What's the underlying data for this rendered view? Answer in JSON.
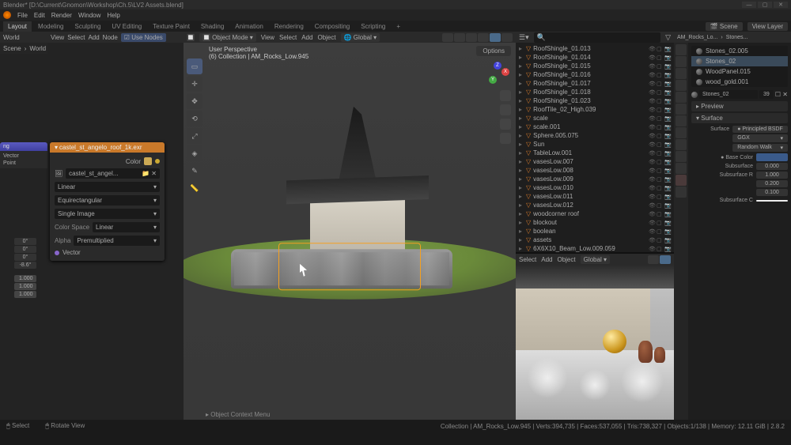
{
  "window": {
    "title": "Blender* [D:\\Current\\Gnomon\\Workshop\\Ch.5\\LV2 Assets.blend]"
  },
  "menubar": {
    "items": [
      "File",
      "Edit",
      "Render",
      "Window",
      "Help"
    ]
  },
  "workspace": {
    "tabs": [
      "Layout",
      "Modeling",
      "Sculpting",
      "UV Editing",
      "Texture Paint",
      "Shading",
      "Animation",
      "Rendering",
      "Compositing",
      "Scripting"
    ],
    "plus": "+",
    "scene": "Scene",
    "viewlayer": "View Layer"
  },
  "node_editor": {
    "header": {
      "mode": "World",
      "menus": [
        "View",
        "Select",
        "Add",
        "Node"
      ],
      "use_nodes": "Use Nodes"
    },
    "breadcrumb": [
      "Scene",
      "World"
    ],
    "frag_node": {
      "title": "ng",
      "sockets": [
        "Vector",
        "Point"
      ],
      "bottom_socket": "Vector"
    },
    "nums": [
      "0°",
      "0°",
      "0°",
      "-8.6°",
      "1.000",
      "1.000",
      "1.000"
    ],
    "image_node": {
      "title": "castel_st_angelo_roof_1k.exr",
      "color_out": "Color",
      "image_field": "castel_st_angel...",
      "interpolation": "Linear",
      "projection": "Equirectangular",
      "frame": "Single Image",
      "color_space_label": "Color Space",
      "color_space": "Linear",
      "alpha_label": "Alpha",
      "alpha": "Premultiplied",
      "vector_in": "Vector"
    }
  },
  "viewport": {
    "mode": "Object Mode",
    "menus": [
      "View",
      "Select",
      "Add",
      "Object"
    ],
    "orientation": "Global",
    "info1": "User Perspective",
    "info2": "(6) Collection | AM_Rocks_Low.945",
    "options": "Options",
    "bottom": "Object Context Menu"
  },
  "outliner": {
    "items": [
      "RoofShingle_01.013",
      "RoofShingle_01.014",
      "RoofShingle_01.015",
      "RoofShingle_01.016",
      "RoofShingle_01.017",
      "RoofShingle_01.018",
      "RoofShingle_01.023",
      "RoofTile_02_High.039",
      "scale",
      "scale.001",
      "Sphere.005.075",
      "Sun",
      "TableLow.001",
      "vasesLow.007",
      "vasesLow.008",
      "vasesLow.009",
      "vasesLow.010",
      "vasesLow.011",
      "vasesLow.012",
      "woodcorner roof",
      "blockout",
      "boolean",
      "assets",
      "6X6X10_Beam_Low.009.059"
    ]
  },
  "secondary": {
    "menus": [
      "Select",
      "Add",
      "Object"
    ],
    "orientation": "Global"
  },
  "properties": {
    "breadcrumb1": "AM_Rocks_Lo...",
    "breadcrumb2": "Stones...",
    "materials": [
      "Stones_02.005",
      "Stones_02",
      "WoodPanel.015",
      "wood_gold.001"
    ],
    "active": "Stones_02",
    "slot_count": "39",
    "preview": "Preview",
    "surface_section": "Surface",
    "surface_label": "Surface",
    "surface_val": "Principled BSDF",
    "ggx": "GGX",
    "random_walk": "Random Walk",
    "base_color": "Base Color",
    "subsurface": "Subsurface",
    "subsurface_val": "0.000",
    "subsurface_r": "Subsurface R",
    "r1": "1.000",
    "r2": "0.200",
    "r3": "0.100",
    "subsurface_c": "Subsurface C"
  },
  "statusbar": {
    "left1": "Select",
    "left2": "Rotate View",
    "right": "Collection | AM_Rocks_Low.945 | Verts:394,735 | Faces:537,055 | Tris:738,327 | Objects:1/138 | Memory: 12.11 GiB | 2.8.2"
  }
}
